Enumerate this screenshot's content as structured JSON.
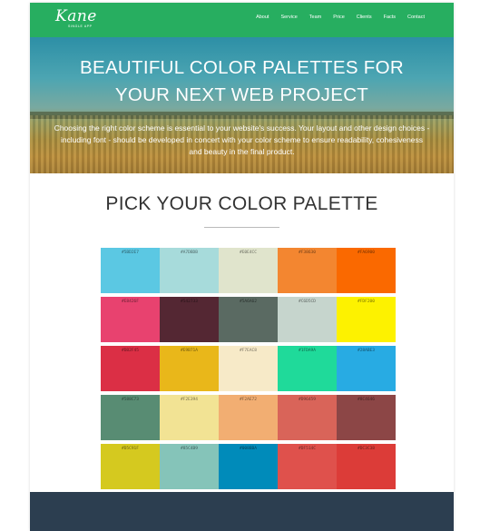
{
  "nav": {
    "logo_name": "Kane",
    "logo_tag": "SINGLE APP",
    "items": [
      "About",
      "Service",
      "Team",
      "Price",
      "Clients",
      "Facts",
      "Contact"
    ]
  },
  "hero": {
    "title_line1": "BEAUTIFUL COLOR PALETTES FOR",
    "title_line2": "YOUR NEXT WEB PROJECT",
    "text": "Choosing the right color scheme is essential to your website's success. Your layout and other design choices - including font - should be developed in concert with your color scheme to ensure readability, cohesiveness and beauty in the final product."
  },
  "section": {
    "title": "PICK YOUR COLOR PALETTE"
  },
  "palette": [
    [
      {
        "hex": "#5BD2E7",
        "color": "#5bc8e3"
      },
      {
        "hex": "#A7DBDB",
        "color": "#a7dbdb"
      },
      {
        "hex": "#E0E4CC",
        "color": "#e0e4cc"
      },
      {
        "hex": "#F38630",
        "color": "#f38630"
      },
      {
        "hex": "#FA6900",
        "color": "#fa6900"
      }
    ],
    [
      {
        "hex": "#E8426F",
        "color": "#e8426f"
      },
      {
        "hex": "#542733",
        "color": "#542733"
      },
      {
        "hex": "#5A6A62",
        "color": "#5a6a62"
      },
      {
        "hex": "#C6D5CD",
        "color": "#c6d5cd"
      },
      {
        "hex": "#FDF200",
        "color": "#fdf200"
      }
    ],
    [
      {
        "hex": "#DB2F45",
        "color": "#db2f45"
      },
      {
        "hex": "#E9B71A",
        "color": "#e9b71a"
      },
      {
        "hex": "#F7EAC8",
        "color": "#f7eac8"
      },
      {
        "hex": "#1FDA9A",
        "color": "#1fda9a"
      },
      {
        "hex": "#28ABE3",
        "color": "#28abe3"
      }
    ],
    [
      {
        "hex": "#588C73",
        "color": "#588c73"
      },
      {
        "hex": "#F2E394",
        "color": "#f2e394"
      },
      {
        "hex": "#F2AE72",
        "color": "#f2ae72"
      },
      {
        "hex": "#D96459",
        "color": "#d96459"
      },
      {
        "hex": "#8C4646",
        "color": "#8c4646"
      }
    ],
    [
      {
        "hex": "#D5C91F",
        "color": "#d5c91f"
      },
      {
        "hex": "#85C4B9",
        "color": "#85c4b9"
      },
      {
        "hex": "#008BBA",
        "color": "#008bba"
      },
      {
        "hex": "#DF514C",
        "color": "#df514c"
      },
      {
        "hex": "#DC3C38",
        "color": "#dc3c38"
      }
    ]
  ]
}
